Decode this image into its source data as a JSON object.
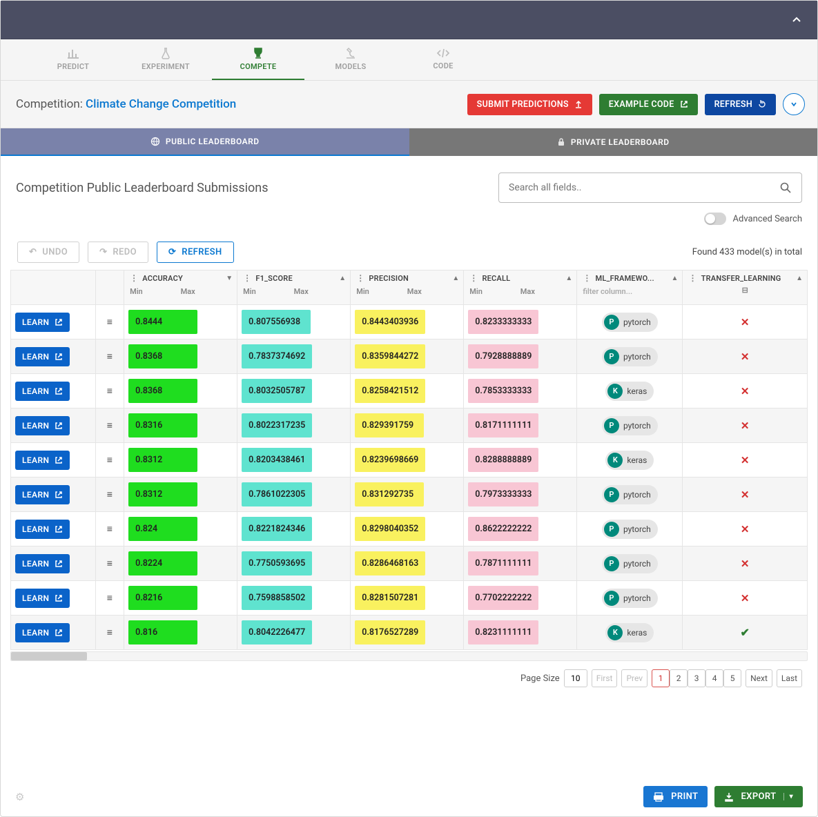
{
  "nav": {
    "predict": "PREDICT",
    "experiment": "EXPERIMENT",
    "compete": "COMPETE",
    "models": "MODELS",
    "code": "CODE"
  },
  "comp": {
    "prefix": "Competition: ",
    "name": "Climate Change Competition",
    "submit": "SUBMIT PREDICTIONS",
    "example": "EXAMPLE CODE",
    "refresh": "REFRESH"
  },
  "lb_tabs": {
    "public": "PUBLIC LEADERBOARD",
    "private": "PRIVATE LEADERBOARD"
  },
  "heading": "Competition Public Leaderboard Submissions",
  "search": {
    "placeholder": "Search all fields.."
  },
  "advanced": "Advanced Search",
  "toolbar": {
    "undo": "UNDO",
    "redo": "REDO",
    "refresh": "REFRESH",
    "total": "Found 433 model(s) in total"
  },
  "columns": {
    "accuracy": "ACCURACY",
    "f1": "F1_SCORE",
    "precision": "PRECISION",
    "recall": "RECALL",
    "framework": "ML_FRAMEWO...",
    "transfer": "TRANSFER_LEARNING",
    "min": "Min",
    "max": "Max",
    "filter": "filter column..."
  },
  "learn_label": "LEARN",
  "rows": [
    {
      "acc": "0.8444",
      "f1": "0.807556938",
      "pre": "0.8443403936",
      "rec": "0.8233333333",
      "fw": "pytorch",
      "fwa": "P",
      "tl": false
    },
    {
      "acc": "0.8368",
      "f1": "0.7837374692",
      "pre": "0.8359844272",
      "rec": "0.7928888889",
      "fw": "pytorch",
      "fwa": "P",
      "tl": false
    },
    {
      "acc": "0.8368",
      "f1": "0.8032505787",
      "pre": "0.8258421512",
      "rec": "0.7853333333",
      "fw": "keras",
      "fwa": "K",
      "tl": false
    },
    {
      "acc": "0.8316",
      "f1": "0.8022317235",
      "pre": "0.829391759",
      "rec": "0.8171111111",
      "fw": "pytorch",
      "fwa": "P",
      "tl": false
    },
    {
      "acc": "0.8312",
      "f1": "0.8203438461",
      "pre": "0.8239698669",
      "rec": "0.8288888889",
      "fw": "keras",
      "fwa": "K",
      "tl": false
    },
    {
      "acc": "0.8312",
      "f1": "0.7861022305",
      "pre": "0.831292735",
      "rec": "0.7973333333",
      "fw": "pytorch",
      "fwa": "P",
      "tl": false
    },
    {
      "acc": "0.824",
      "f1": "0.8221824346",
      "pre": "0.8298040352",
      "rec": "0.8622222222",
      "fw": "pytorch",
      "fwa": "P",
      "tl": false
    },
    {
      "acc": "0.8224",
      "f1": "0.7750593695",
      "pre": "0.8286468163",
      "rec": "0.7871111111",
      "fw": "pytorch",
      "fwa": "P",
      "tl": false
    },
    {
      "acc": "0.8216",
      "f1": "0.7598858502",
      "pre": "0.8281507281",
      "rec": "0.7702222222",
      "fw": "pytorch",
      "fwa": "P",
      "tl": false
    },
    {
      "acc": "0.816",
      "f1": "0.8042226477",
      "pre": "0.8176527289",
      "rec": "0.8231111111",
      "fw": "keras",
      "fwa": "K",
      "tl": true
    }
  ],
  "pager": {
    "page_size_lbl": "Page Size",
    "page_size": "10",
    "first": "First",
    "prev": "Prev",
    "next": "Next",
    "last": "Last",
    "pages": [
      "1",
      "2",
      "3",
      "4",
      "5"
    ]
  },
  "footer": {
    "print": "PRINT",
    "export": "EXPORT"
  }
}
